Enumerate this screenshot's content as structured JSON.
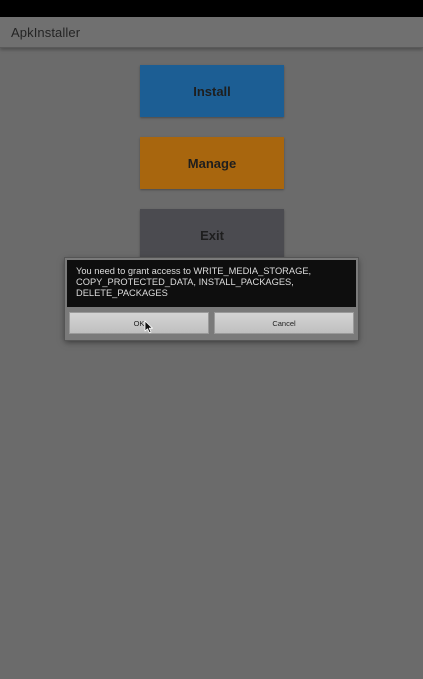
{
  "app_bar": {
    "title": "ApkInstaller"
  },
  "buttons": [
    {
      "label": "Install",
      "color": "#1c5e94"
    },
    {
      "label": "Manage",
      "color": "#a8660e"
    },
    {
      "label": "Exit",
      "color": "#4b4b50"
    }
  ],
  "dialog": {
    "message": "You need to grant access to WRITE_MEDIA_STORAGE, COPY_PROTECTED_DATA, INSTALL_PACKAGES, DELETE_PACKAGES",
    "ok_label": "OK",
    "cancel_label": "Cancel"
  },
  "colors": {
    "screen_background": "#6b6b6b",
    "status_bar": "#000000",
    "app_bar": "#707070",
    "dialog_message_background": "#0e0e0e"
  },
  "icons": {
    "pointer": "mouse-cursor-icon"
  }
}
